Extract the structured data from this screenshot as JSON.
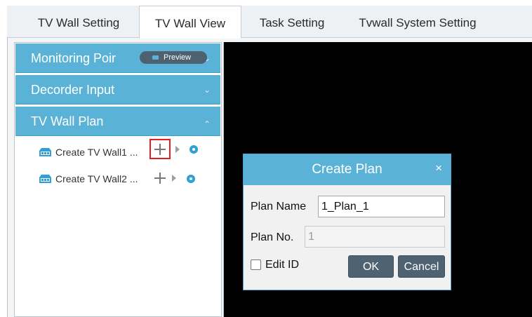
{
  "tabs": [
    {
      "label": "TV Wall Setting"
    },
    {
      "label": "TV Wall View"
    },
    {
      "label": "Task Setting"
    },
    {
      "label": "Tvwall System Setting"
    }
  ],
  "sidebar": {
    "monitoring_label": "Monitoring Poir",
    "preview_label": "Preview",
    "decoder_label": "Decorder Input",
    "plan_label": "TV Wall Plan",
    "tree": [
      {
        "label": "Create TV Wall1 ..."
      },
      {
        "label": "Create TV Wall2 ..."
      }
    ]
  },
  "dialog": {
    "title": "Create Plan",
    "close": "×",
    "plan_name_label": "Plan Name",
    "plan_name_value": "1_Plan_1",
    "plan_no_label": "Plan No.",
    "plan_no_value": "1",
    "edit_id_label": "Edit ID",
    "ok_label": "OK",
    "cancel_label": "Cancel"
  },
  "colors": {
    "accent": "#5ab3d6",
    "button_dark": "#4e6272",
    "highlight": "#e02020"
  }
}
